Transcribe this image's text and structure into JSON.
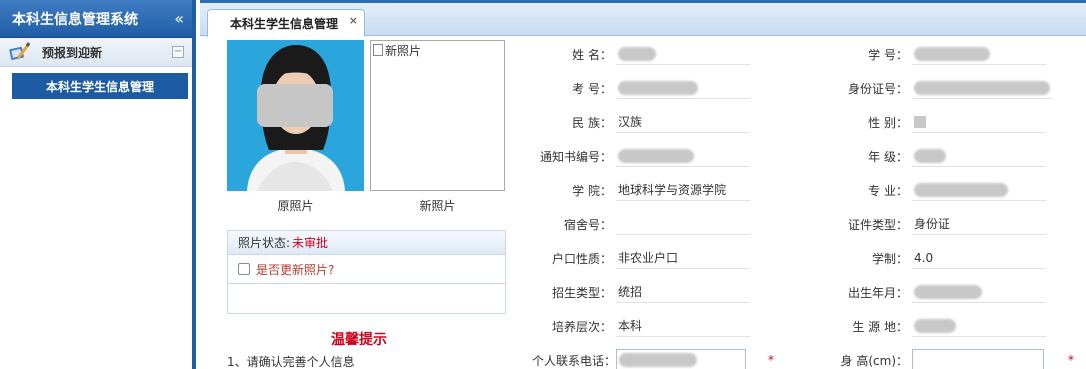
{
  "sidebar": {
    "title": "本科生信息管理系统",
    "collapse_icon": "«",
    "group": {
      "label": "预报到迎新",
      "toggle": "−"
    },
    "items": [
      {
        "label": "本科生学生信息管理"
      }
    ]
  },
  "tabs": [
    {
      "label": "本科生学生信息管理",
      "close": "×"
    }
  ],
  "photos": {
    "original_caption": "原照片",
    "new_caption": "新照片",
    "new_alt": "新照片"
  },
  "photo_status": {
    "label": "照片状态:",
    "value": "未审批",
    "update_checkbox_label": "是否更新照片?"
  },
  "tips": {
    "title": "温馨提示",
    "lines": [
      "1、请确认完善个人信息"
    ]
  },
  "form": {
    "left": [
      {
        "label": "姓 名：",
        "value": ""
      },
      {
        "label": "考 号：",
        "value": ""
      },
      {
        "label": "民 族：",
        "value": "汉族"
      },
      {
        "label": "通知书编号：",
        "value": ""
      },
      {
        "label": "学 院：",
        "value": "地球科学与资源学院"
      },
      {
        "label": "宿舍号：",
        "value": ""
      },
      {
        "label": "户口性质：",
        "value": "非农业户口"
      },
      {
        "label": "招生类型：",
        "value": "统招"
      },
      {
        "label": "培养层次：",
        "value": "本科"
      },
      {
        "label": "个人联系电话：",
        "value": ""
      }
    ],
    "right": [
      {
        "label": "学 号：",
        "value": ""
      },
      {
        "label": "身份证号：",
        "value": ""
      },
      {
        "label": "性 别：",
        "value": ""
      },
      {
        "label": "年 级：",
        "value": ""
      },
      {
        "label": "专 业：",
        "value": ""
      },
      {
        "label": "证件类型：",
        "value": "身份证"
      },
      {
        "label": "学制：",
        "value": "4.0"
      },
      {
        "label": "出生年月：",
        "value": ""
      },
      {
        "label": "生 源 地：",
        "value": ""
      },
      {
        "label": "身 高(cm)：",
        "value": ""
      }
    ],
    "required_mark": "*"
  },
  "colors": {
    "brand_blue": "#1c5ba1",
    "status_red": "#d0021b"
  }
}
